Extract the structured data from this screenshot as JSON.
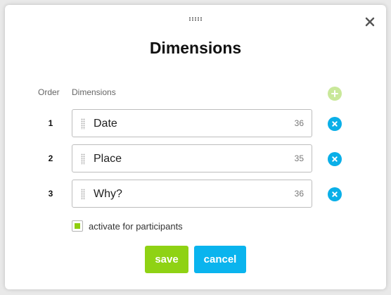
{
  "dialog": {
    "title": "Dimensions",
    "close_icon": "close-icon",
    "drag_icon": "drag-grip-icon"
  },
  "table": {
    "order_header": "Order",
    "dimensions_header": "Dimensions",
    "add_icon": "plus-icon",
    "rows": [
      {
        "order": "1",
        "label": "Date",
        "count": "36"
      },
      {
        "order": "2",
        "label": "Place",
        "count": "35"
      },
      {
        "order": "3",
        "label": "Why?",
        "count": "36"
      }
    ]
  },
  "participants": {
    "label": "activate for participants",
    "checked": true
  },
  "actions": {
    "save_label": "save",
    "cancel_label": "cancel"
  },
  "colors": {
    "add_button": "#c9e89a",
    "remove_button": "#0aafe8",
    "save_button": "#8fd214",
    "cancel_button": "#0ab4ee",
    "checkbox_fill": "#8fce10"
  }
}
